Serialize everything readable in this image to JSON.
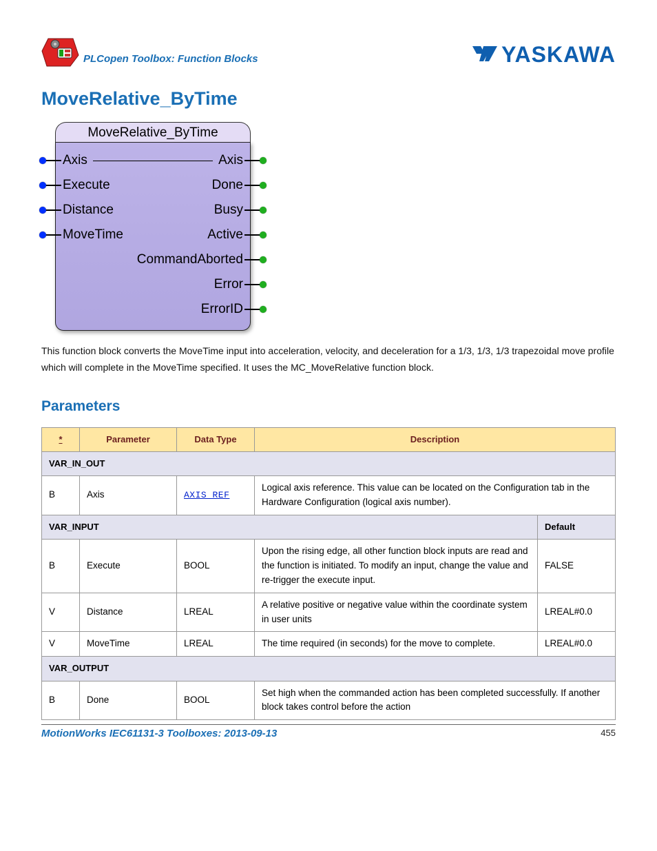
{
  "header": {
    "breadcrumb": "PLCopen Toolbox: Function Blocks",
    "brand": "YASKAWA"
  },
  "title": "MoveRelative_ByTime",
  "fb": {
    "name": "MoveRelative_ByTime",
    "inputs": [
      "Axis",
      "Execute",
      "Distance",
      "MoveTime"
    ],
    "outputs": [
      "Axis",
      "Done",
      "Busy",
      "Active",
      "CommandAborted",
      "Error",
      "ErrorID"
    ]
  },
  "description": "This function block converts the MoveTime input into acceleration, velocity, and deceleration for a 1/3, 1/3, 1/3 trapezoidal move profile which will complete in the MoveTime specified.  It uses the MC_MoveRelative function block.",
  "parameters_heading": "Parameters",
  "table": {
    "headers": {
      "flag": "*",
      "param": "Parameter",
      "type": "Data Type",
      "desc": "Description",
      "default": "Default"
    },
    "sections": {
      "var_in_out": "VAR_IN_OUT",
      "var_input": "VAR_INPUT",
      "var_output": "VAR_OUTPUT"
    },
    "rows": {
      "axis": {
        "flag": "B",
        "param": "Axis",
        "type": "AXIS_REF",
        "type_link": true,
        "desc": "Logical axis reference. This value can be located on the Configuration tab in the Hardware Configuration (logical axis number)."
      },
      "execute": {
        "flag": "B",
        "param": "Execute",
        "type": "BOOL",
        "desc": "Upon the rising edge, all other function block inputs are read and the function is initiated. To modify an input, change the value and re-trigger the execute input.",
        "default": "FALSE"
      },
      "distance": {
        "flag": "V",
        "param": "Distance",
        "type": "LREAL",
        "desc": "A relative positive or negative value within the coordinate system in user units",
        "default": "LREAL#0.0"
      },
      "movetime": {
        "flag": "V",
        "param": "MoveTime",
        "type": "LREAL",
        "desc": "The time required (in seconds) for the move to complete.",
        "default": "LREAL#0.0"
      },
      "done": {
        "flag": "B",
        "param": "Done",
        "type": "BOOL",
        "desc": "Set high when the commanded action has been completed successfully. If another block takes control before the action"
      }
    }
  },
  "footer": {
    "text": "MotionWorks IEC61131-3 Toolboxes: 2013-09-13",
    "page": "455"
  }
}
